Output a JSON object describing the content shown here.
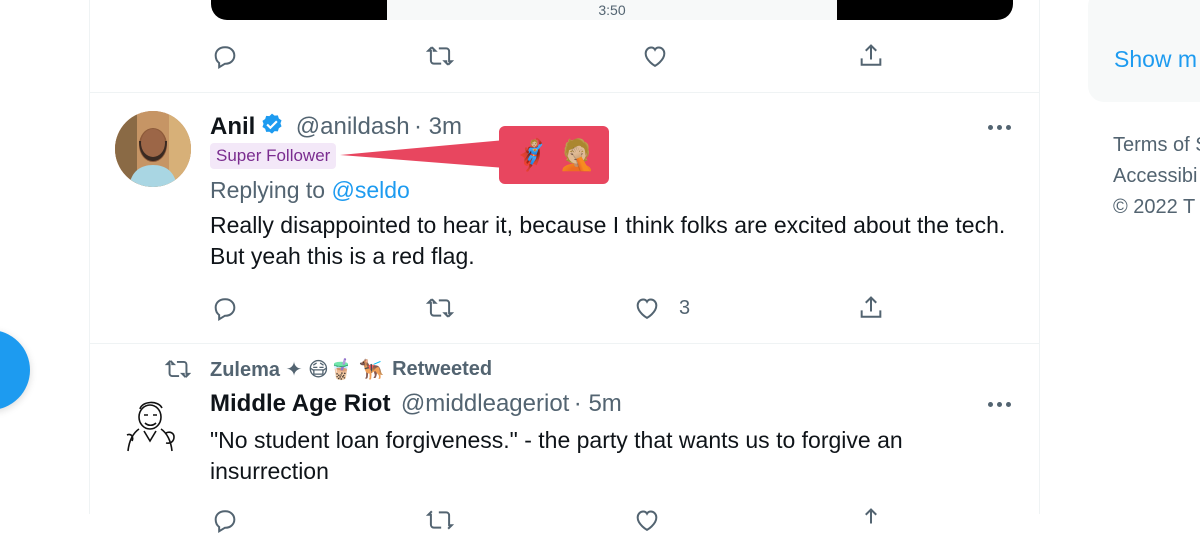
{
  "video": {
    "time": "3:50"
  },
  "tweets": [
    {
      "name": "Anil",
      "handle": "@anildash",
      "time": "· 3m",
      "badge": "Super Follower",
      "callout_emoji": "🦸🏼 🤦🏼",
      "replying_prefix": "Replying to ",
      "replying_to": "@seldo",
      "text": "Really disappointed to hear it, because I think folks are excited about the tech. But yeah this is a red flag.",
      "like_count": "3"
    },
    {
      "retweeted_by": "Zulema ✦ 😷🧋 🐕‍🦺",
      "retweeted_label": "Retweeted",
      "name": "Middle Age Riot",
      "handle": "@middleageriot",
      "time": "· 5m",
      "text": "\"No student loan forgiveness.\" - the party that wants us to forgive an insurrection"
    }
  ],
  "sidebar": {
    "show_more": "Show m",
    "links": [
      "Terms of S",
      "Accessibi",
      "© 2022 T"
    ]
  },
  "icons": [
    "reply-icon",
    "retweet-icon",
    "like-icon",
    "share-icon",
    "verified-icon",
    "more-icon"
  ],
  "colors": {
    "accent": "#1d9bf0",
    "badge_bg": "#f3e8f8",
    "badge_text": "#7a2c8f",
    "callout": "#e8465f"
  }
}
